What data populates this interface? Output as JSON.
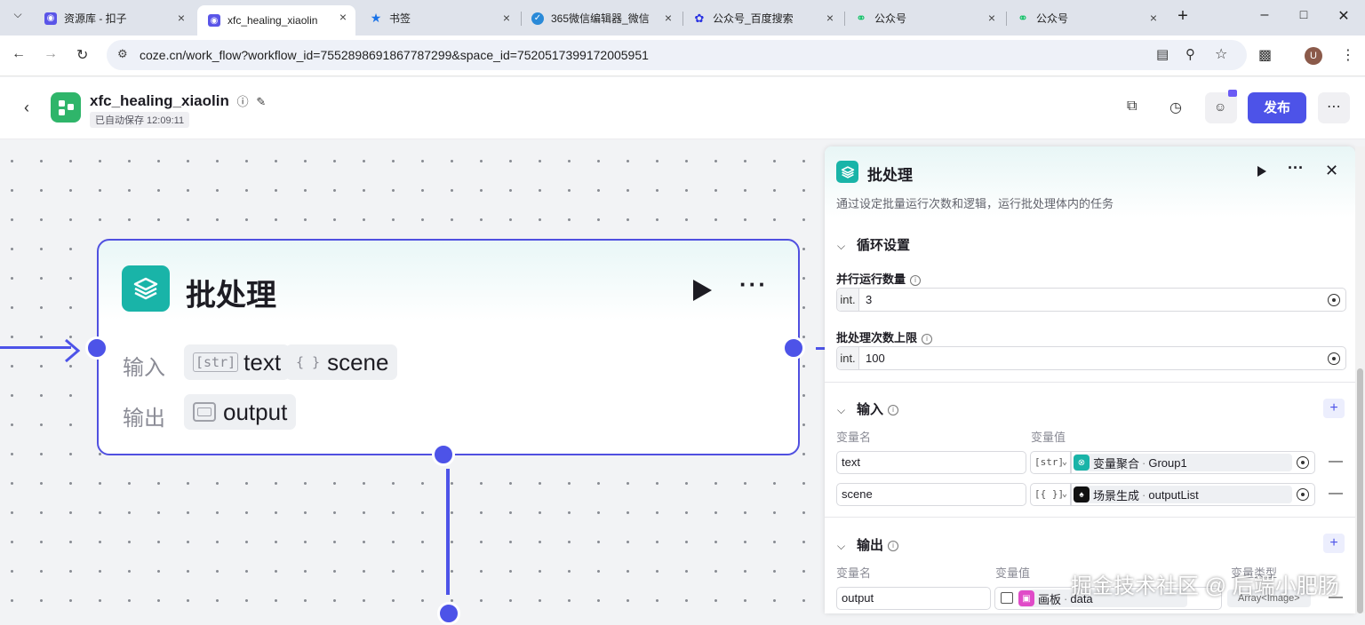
{
  "browser": {
    "tabs": [
      {
        "title": "资源库 - 扣子",
        "active": false
      },
      {
        "title": "xfc_healing_xiaolin",
        "active": true
      },
      {
        "title": "书签",
        "active": false
      },
      {
        "title": "365微信编辑器_微信",
        "active": false
      },
      {
        "title": "公众号_百度搜索",
        "active": false
      },
      {
        "title": "公众号",
        "active": false
      },
      {
        "title": "公众号",
        "active": false
      }
    ],
    "url": "coze.cn/work_flow?workflow_id=7552898691867787299&space_id=7520517399172005951",
    "profile_initial": "U"
  },
  "header": {
    "workflow_name": "xfc_healing_xiaolin",
    "autosave": "已自动保存 12:09:11",
    "publish_label": "发布"
  },
  "node": {
    "title": "批处理",
    "input_label": "输入",
    "output_label": "输出",
    "inputs": [
      {
        "type_tag": "[str]",
        "name": "text"
      },
      {
        "type_tag": "{ }",
        "name": "scene"
      }
    ],
    "outputs": [
      {
        "type_tag": "img",
        "name": "output"
      }
    ]
  },
  "panel": {
    "title": "批处理",
    "description": "通过设定批量运行次数和逻辑，运行批处理体内的任务",
    "loop_section": "循环设置",
    "parallel_label": "并行运行数量",
    "parallel_prefix": "int.",
    "parallel_value": "3",
    "max_label": "批处理次数上限",
    "max_prefix": "int.",
    "max_value": "100",
    "input_section": "输入",
    "input_col_name": "变量名",
    "input_col_value": "变量值",
    "inputs": [
      {
        "name": "text",
        "type_tag": "[str]",
        "ref_source": "变量聚合",
        "ref_field": "Group1",
        "ref_color": "#19b4a8"
      },
      {
        "name": "scene",
        "type_tag": "[{ }]",
        "ref_source": "场景生成",
        "ref_field": "outputList",
        "ref_color": "#111111"
      }
    ],
    "output_section": "输出",
    "output_col_name": "变量名",
    "output_col_value": "变量值",
    "output_col_type": "变量类型",
    "outputs": [
      {
        "name": "output",
        "ref_source": "画板",
        "ref_field": "data",
        "type": "Array<Image>",
        "ref_color": "#e04bc8"
      }
    ]
  },
  "watermark": "掘金技术社区 @ 后端小肥肠"
}
